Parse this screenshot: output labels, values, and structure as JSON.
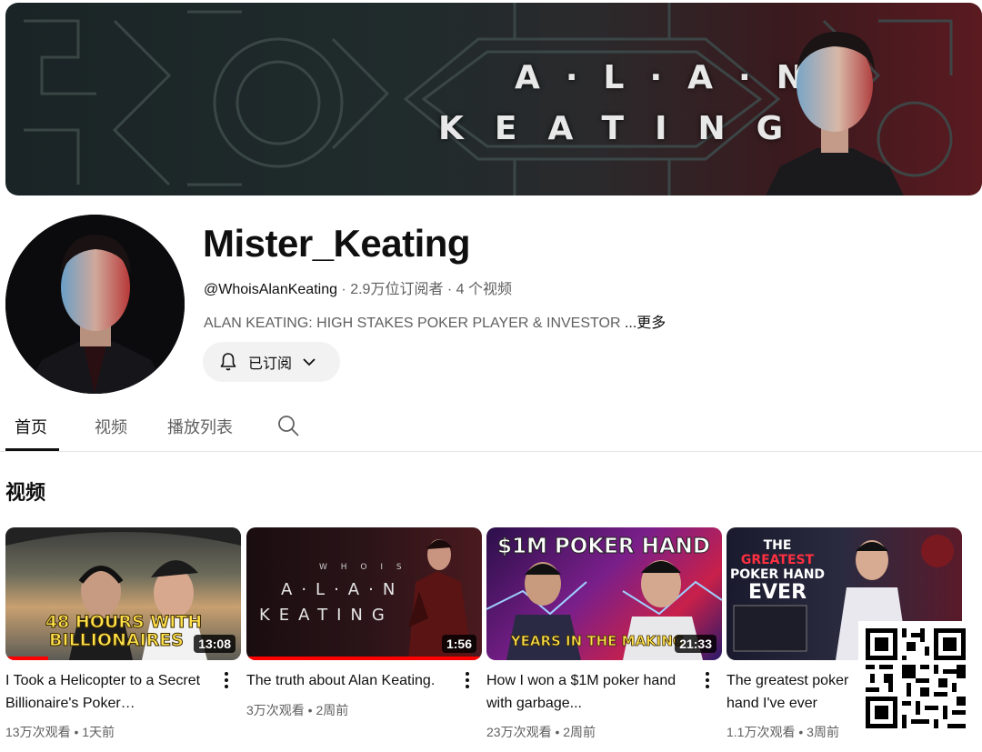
{
  "banner": {
    "line1": "A·L·A·N",
    "line2": "KEATING"
  },
  "channel": {
    "name": "Mister_Keating",
    "handle": "@WhoisAlanKeating",
    "subscribers": "2.9万位订阅者",
    "video_count": "4 个视频",
    "separator": " · ",
    "description": "ALAN KEATING: HIGH STAKES POKER PLAYER & INVESTOR ",
    "more_label": "...更多",
    "subscribe_label": "已订阅"
  },
  "tabs": [
    {
      "label": "首页",
      "active": true
    },
    {
      "label": "视频",
      "active": false
    },
    {
      "label": "播放列表",
      "active": false
    }
  ],
  "section": {
    "title": "视频"
  },
  "videos": [
    {
      "thumb_text": "48 HOURS WITH BILLIONAIRES",
      "duration": "13:08",
      "progress": 0.18,
      "title": "I Took a Helicopter to a Secret Billionaire's Poker…",
      "views": "13万次观看",
      "age": "1天前"
    },
    {
      "thumb_text": "WHO IS · ALAN · KEATING",
      "duration": "1:56",
      "progress": 1.0,
      "title": "The truth about Alan Keating.",
      "views": "3万次观看",
      "age": "2周前"
    },
    {
      "thumb_text": "$1M POKER HAND",
      "thumb_sub": "YEARS IN THE MAKING",
      "duration": "21:33",
      "progress": 0,
      "title": "How I won a $1M poker hand with garbage...",
      "views": "23万次观看",
      "age": "2周前"
    },
    {
      "thumb_text": "THE GREATEST POKER HAND EVER",
      "duration": "",
      "progress": 0,
      "title": "The greatest poker hand I've ever played...",
      "views": "1.1万次观看",
      "age": "3周前"
    }
  ],
  "stats_separator": " • ",
  "colors": {
    "accent_red": "#ff0000",
    "text_primary": "#0f0f0f",
    "text_secondary": "#606060",
    "chip_bg": "#f2f2f2"
  },
  "icons": [
    "bell-icon",
    "chevron-down-icon",
    "search-icon",
    "more-vert-icon",
    "qr-code-icon"
  ]
}
